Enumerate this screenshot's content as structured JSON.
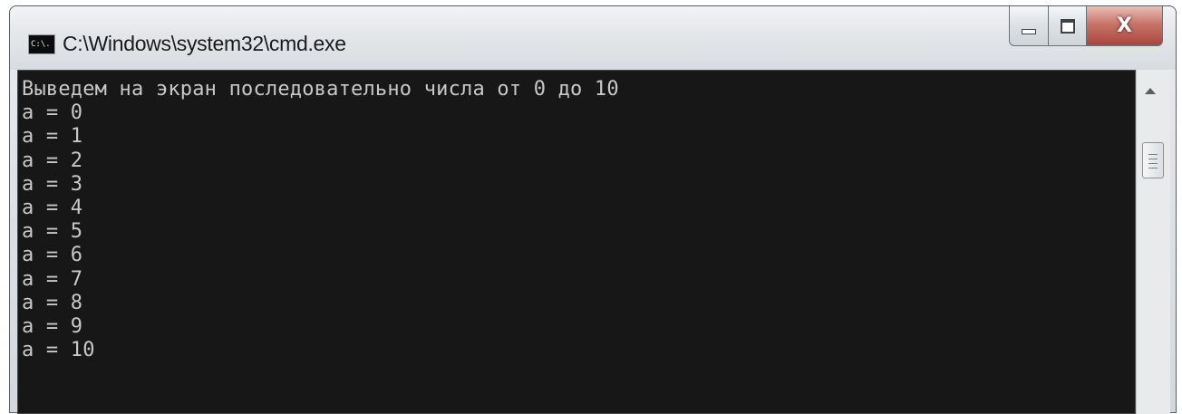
{
  "window": {
    "title": "C:\\Windows\\system32\\cmd.exe",
    "icon": "cmd-icon",
    "icon_text": "C:\\.",
    "buttons": {
      "minimize": "minimize-icon",
      "maximize": "maximize-icon",
      "close_label": "X"
    }
  },
  "console": {
    "background": "#171717",
    "foreground": "#c8c8c8",
    "lines": [
      "Выведем на экран последовательно числа от 0 до 10",
      "a = 0",
      "a = 1",
      "a = 2",
      "a = 3",
      "a = 4",
      "a = 5",
      "a = 6",
      "a = 7",
      "a = 8",
      "a = 9",
      "a = 10"
    ]
  },
  "scrollbar": {
    "up_arrow": "scroll-up-arrow-icon"
  }
}
